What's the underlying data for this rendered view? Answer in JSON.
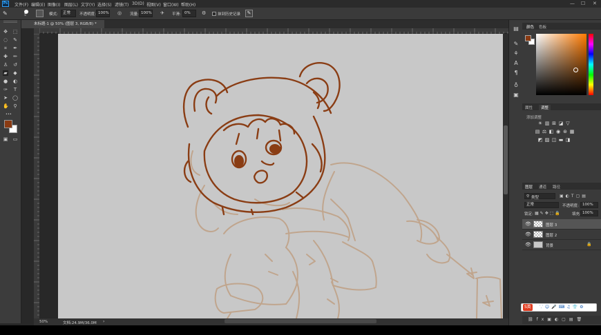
{
  "menubar": {
    "logo": "Ps",
    "items": [
      "文件(F)",
      "编辑(E)",
      "图像(I)",
      "图层(L)",
      "文字(Y)",
      "选择(S)",
      "滤镜(T)",
      "3D(D)",
      "视图(V)",
      "窗口(W)",
      "帮助(H)"
    ],
    "minimize": "—",
    "maximize": "☐",
    "close": "✕"
  },
  "options": {
    "brush_size": "5",
    "mode_label": "模式:",
    "mode_value": "正常",
    "opacity_label": "不透明度:",
    "opacity_value": "100%",
    "flow_label": "流量:",
    "flow_value": "100%",
    "smooth_label": "平滑:",
    "smooth_value": "0%",
    "erase_history_label": "抹到历史记录"
  },
  "document": {
    "tab_title": "未标题-1 @ 50% (图层 3, RGB/8) *",
    "zoom": "50%",
    "doc_size": "文档:24.9M/36.0M"
  },
  "colors": {
    "foreground": "#8a3a12",
    "background": "#ffffff",
    "sketch_dark": "#8a3d14",
    "sketch_light": "#c0a58d",
    "canvas": "#c8c8c8"
  },
  "color_panel": {
    "tabs": [
      "颜色",
      "色板"
    ]
  },
  "adjust_panel": {
    "tabs": [
      "属性",
      "调整"
    ],
    "add_label": "添加调整"
  },
  "layers_panel": {
    "tabs": [
      "图层",
      "通道",
      "路径"
    ],
    "filter_kind": "类型",
    "blend_mode": "正常",
    "opacity_label": "不透明度:",
    "opacity_value": "100%",
    "lock_label": "锁定:",
    "fill_label": "填充:",
    "fill_value": "100%",
    "layers": [
      {
        "name": "图层 3",
        "selected": true
      },
      {
        "name": "图层 2",
        "selected": false
      },
      {
        "name": "背景",
        "selected": false
      }
    ]
  },
  "ime": {
    "label": "S英"
  }
}
